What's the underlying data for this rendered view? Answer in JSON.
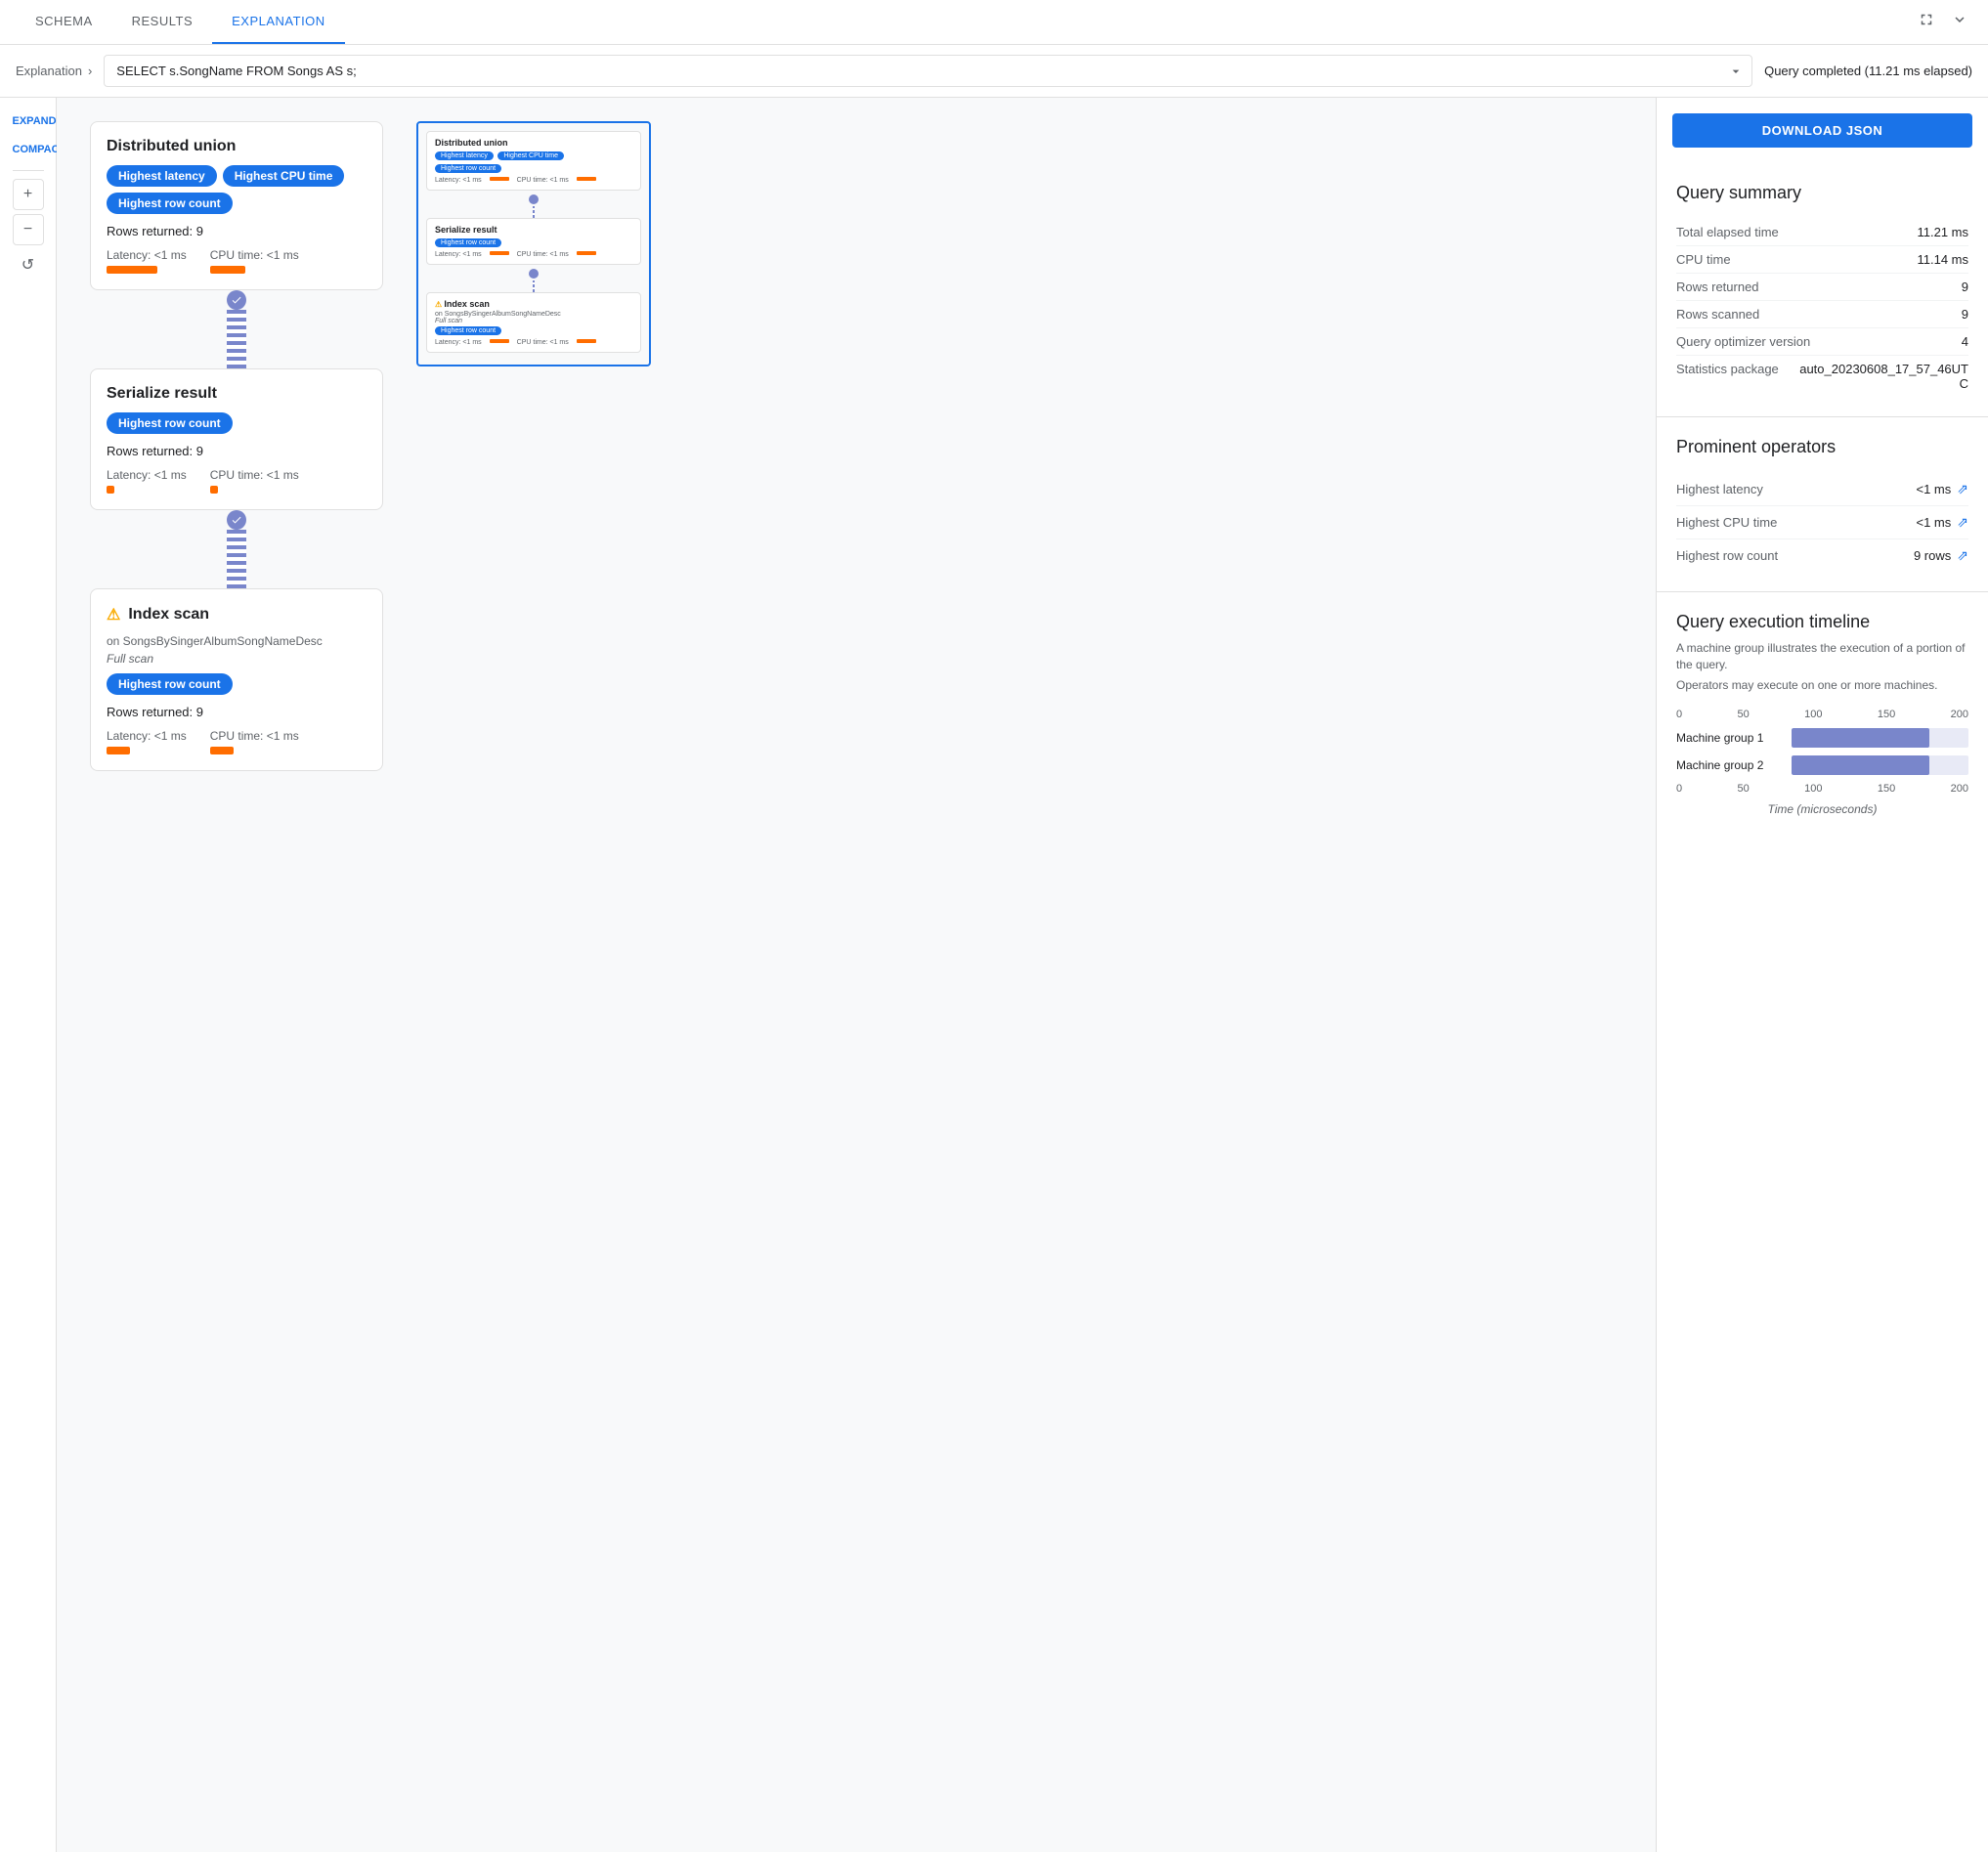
{
  "tabs": [
    {
      "id": "schema",
      "label": "SCHEMA",
      "active": false
    },
    {
      "id": "results",
      "label": "RESULTS",
      "active": false
    },
    {
      "id": "explanation",
      "label": "EXPLANATION",
      "active": true
    }
  ],
  "query_bar": {
    "breadcrumb": "Explanation",
    "query_value": "SELECT s.SongName FROM Songs AS s;",
    "query_status": "Query completed (11.21 ms elapsed)"
  },
  "toolbar": {
    "expanded_label": "EXPANDED",
    "compact_label": "COMPACT",
    "zoom_in": "+",
    "zoom_out": "−",
    "reset": "↺",
    "download_btn": "DOWNLOAD JSON"
  },
  "nodes": [
    {
      "id": "distributed-union",
      "title": "Distributed union",
      "badges": [
        "Highest latency",
        "Highest CPU time",
        "Highest row count"
      ],
      "rows_returned": "Rows returned: 9",
      "latency": "Latency: <1 ms",
      "cpu_time": "CPU time: <1 ms",
      "latency_bar_width": 52,
      "cpu_bar_width": 36
    },
    {
      "id": "serialize-result",
      "title": "Serialize result",
      "badges": [
        "Highest row count"
      ],
      "rows_returned": "Rows returned: 9",
      "latency": "Latency: <1 ms",
      "cpu_time": "CPU time: <1 ms",
      "latency_bar_width": 8,
      "cpu_bar_width": 8
    },
    {
      "id": "index-scan",
      "title": "Index scan",
      "warning": true,
      "subtitle": "on SongsBySingerAlbumSongNameDesc",
      "italic": "Full scan",
      "badges": [
        "Highest row count"
      ],
      "rows_returned": "Rows returned: 9",
      "latency": "Latency: <1 ms",
      "cpu_time": "CPU time: <1 ms",
      "latency_bar_width": 24,
      "cpu_bar_width": 24
    }
  ],
  "mini_map": {
    "nodes": [
      {
        "title": "Distributed union",
        "badges": [
          "Highest latency",
          "Highest CPU time",
          "Highest row count"
        ]
      },
      {
        "title": "Serialize result",
        "badges": [
          "Highest row count"
        ]
      },
      {
        "title": "Index scan",
        "badges": [
          "Highest row count"
        ],
        "warning": true,
        "subtitle": "on SongsBySingerAlbumSongNameDesc",
        "italic": "Full scan"
      }
    ]
  },
  "query_summary": {
    "title": "Query summary",
    "rows": [
      {
        "label": "Total elapsed time",
        "value": "11.21 ms"
      },
      {
        "label": "CPU time",
        "value": "11.14 ms"
      },
      {
        "label": "Rows returned",
        "value": "9"
      },
      {
        "label": "Rows scanned",
        "value": "9"
      },
      {
        "label": "Query optimizer version",
        "value": "4"
      },
      {
        "label": "Statistics package",
        "value": "auto_20230608_17_57_46UTC"
      }
    ]
  },
  "prominent_operators": {
    "title": "Prominent operators",
    "rows": [
      {
        "label": "Highest latency",
        "value": "<1 ms"
      },
      {
        "label": "Highest CPU time",
        "value": "<1 ms"
      },
      {
        "label": "Highest row count",
        "value": "9 rows"
      }
    ]
  },
  "execution_timeline": {
    "title": "Query execution timeline",
    "desc1": "A machine group illustrates the execution of a portion of the query.",
    "desc2": "Operators may execute on one or more machines.",
    "axis_labels": [
      "0",
      "50",
      "100",
      "150",
      "200"
    ],
    "bars": [
      {
        "label": "Machine group 1",
        "width_pct": 78
      },
      {
        "label": "Machine group 2",
        "width_pct": 78
      }
    ],
    "x_axis_label": "Time (microseconds)"
  }
}
